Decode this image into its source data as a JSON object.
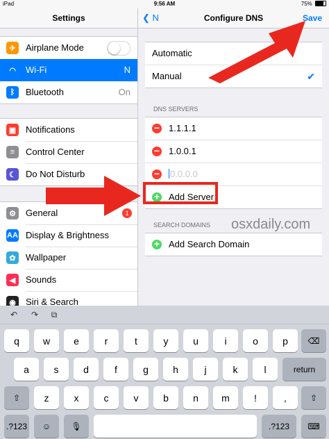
{
  "status_bar": {
    "device": "iPad",
    "wifi": "wifi-icon",
    "time": "9:56 AM",
    "battery_text": "75%"
  },
  "master": {
    "title": "Settings",
    "groups": [
      [
        {
          "label": "Airplane Mode",
          "icon": "airplane-icon",
          "color": "#ff9500",
          "glyph": "✈",
          "toggle": true
        },
        {
          "label": "Wi-Fi",
          "icon": "wifi-icon",
          "color": "#007aff",
          "glyph": "◠",
          "value": "N",
          "selected": true
        },
        {
          "label": "Bluetooth",
          "icon": "bluetooth-icon",
          "color": "#007aff",
          "glyph": "ᛒ",
          "value": "On"
        }
      ],
      [
        {
          "label": "Notifications",
          "icon": "notifications-icon",
          "color": "#ff3b30",
          "glyph": "▣"
        },
        {
          "label": "Control Center",
          "icon": "control-center-icon",
          "color": "#8e8e93",
          "glyph": "≡"
        },
        {
          "label": "Do Not Disturb",
          "icon": "moon-icon",
          "color": "#5856d6",
          "glyph": "☾"
        }
      ],
      [
        {
          "label": "General",
          "icon": "gear-icon",
          "color": "#8e8e93",
          "glyph": "⚙",
          "badge": "1"
        },
        {
          "label": "Display & Brightness",
          "icon": "display-icon",
          "color": "#007aff",
          "glyph": "AA"
        },
        {
          "label": "Wallpaper",
          "icon": "wallpaper-icon",
          "color": "#34aadc",
          "glyph": "✿"
        },
        {
          "label": "Sounds",
          "icon": "sounds-icon",
          "color": "#ff2d55",
          "glyph": "◀"
        },
        {
          "label": "Siri & Search",
          "icon": "siri-icon",
          "color": "#222222",
          "glyph": "◉"
        }
      ]
    ]
  },
  "detail": {
    "back_label": "N",
    "title": "Configure DNS",
    "save_label": "Save",
    "modes": [
      {
        "label": "Automatic",
        "checked": false
      },
      {
        "label": "Manual",
        "checked": true
      }
    ],
    "dns_header": "DNS SERVERS",
    "servers": [
      "1.1.1.1",
      "1.0.0.1"
    ],
    "new_server_placeholder": "0.0.0.0",
    "add_server_label": "Add Server",
    "search_header": "SEARCH DOMAINS",
    "add_search_label": "Add Search Domain",
    "watermark": "osxdaily.com"
  },
  "keyboard": {
    "toolbar": {
      "undo": "↶",
      "redo": "↷",
      "paste": "⧉"
    },
    "row1": [
      "q",
      "w",
      "e",
      "r",
      "t",
      "y",
      "u",
      "i",
      "o",
      "p"
    ],
    "row2": [
      "a",
      "s",
      "d",
      "f",
      "g",
      "h",
      "j",
      "k",
      "l"
    ],
    "row3": [
      "z",
      "x",
      "c",
      "v",
      "b",
      "n",
      "m",
      "!",
      ","
    ],
    "backspace": "⌫",
    "return_label": "return",
    "shift": "⇧",
    "num_label": ".?123",
    "emoji": "☺",
    "mic": "🎙",
    "hide": "⌨"
  },
  "colors": {
    "accent": "#007aff",
    "highlight": "#e8281f"
  }
}
